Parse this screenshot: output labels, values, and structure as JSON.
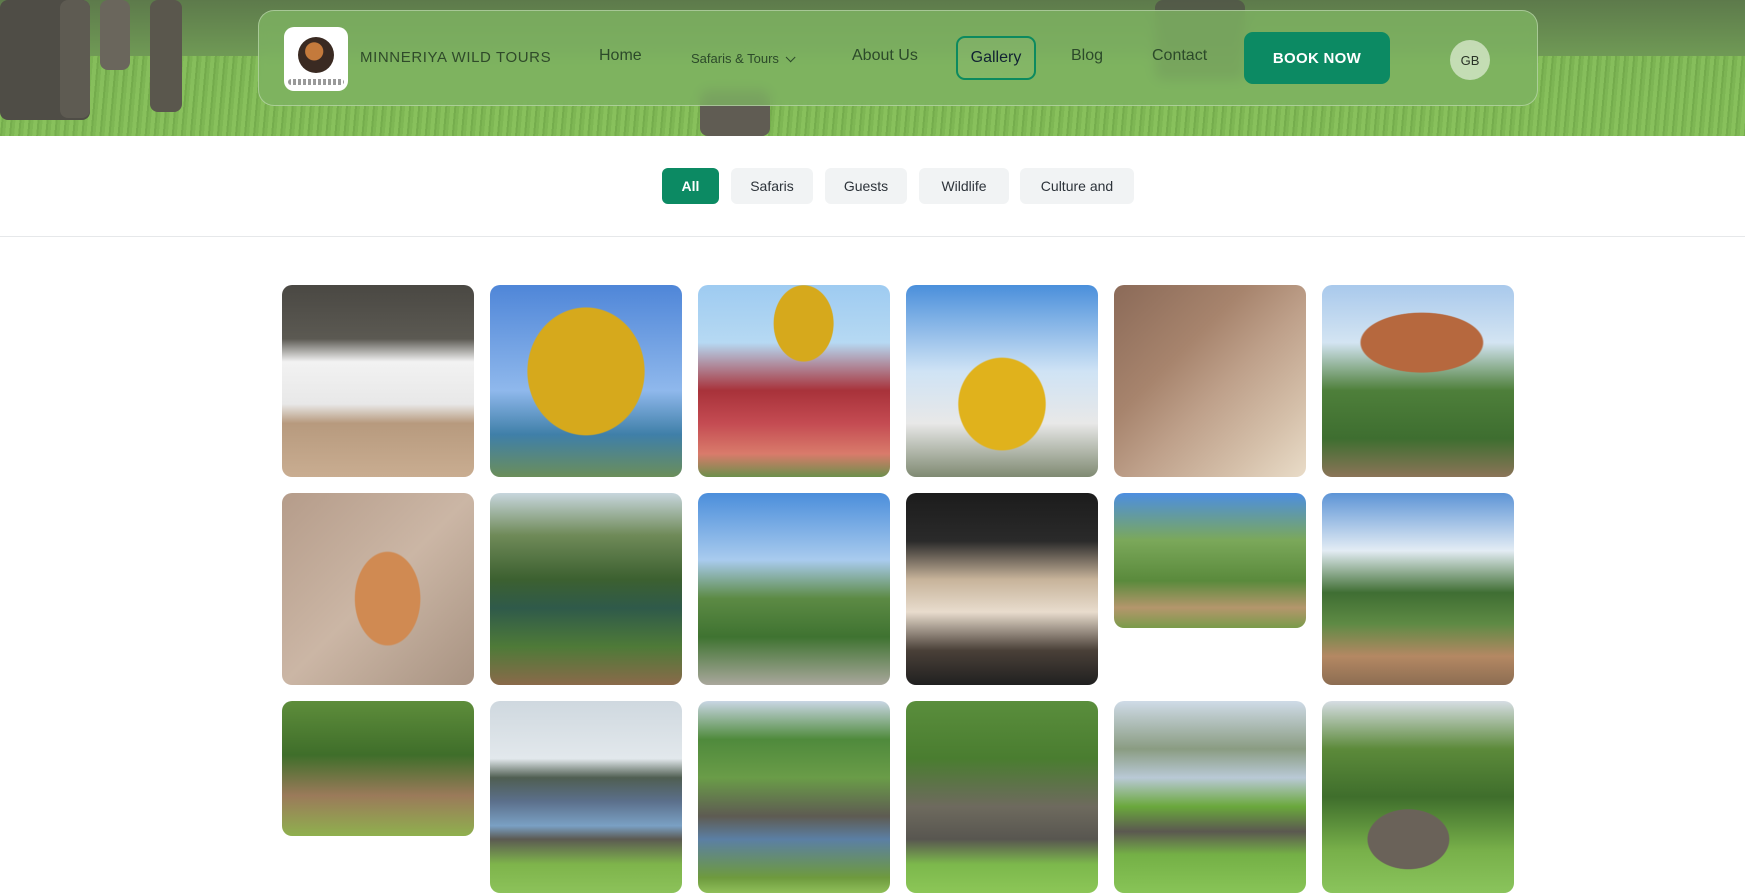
{
  "nav": {
    "brand": "MINNERIYA WILD TOURS",
    "links": {
      "home": "Home",
      "safaris": "Safaris & Tours",
      "about": "About Us",
      "gallery": "Gallery",
      "blog": "Blog",
      "contact": "Contact"
    },
    "book_now": "BOOK NOW",
    "language": "GB",
    "active_link": "Gallery"
  },
  "filters": {
    "items": [
      "All",
      "Safaris",
      "Guests",
      "Wildlife",
      "Culture and"
    ],
    "active": "All"
  },
  "colors": {
    "accent": "#0c8a63",
    "navbar": "#7eb262",
    "chip_bg": "#f1f3f4"
  },
  "icons": {
    "dropdown": "chevron-down-icon"
  }
}
